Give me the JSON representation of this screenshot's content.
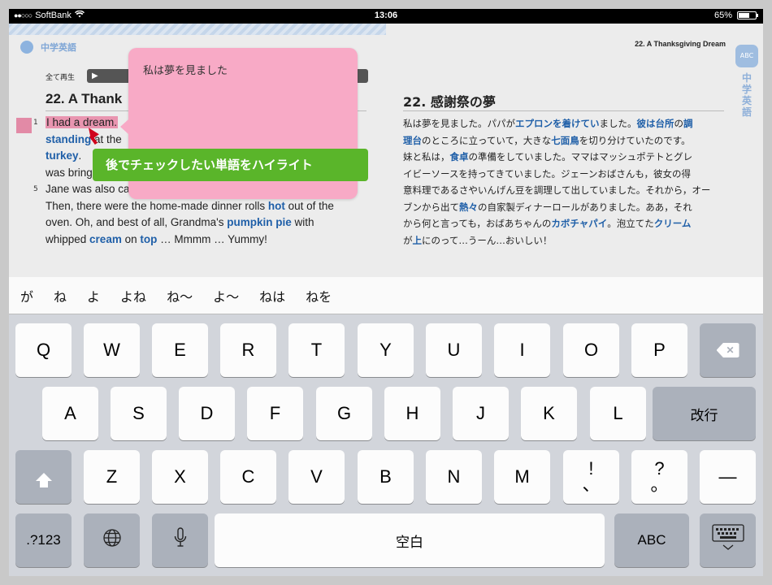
{
  "status_bar": {
    "carrier": "SoftBank",
    "time": "13:06",
    "battery": "65%",
    "battery_level": 0.65
  },
  "app": {
    "logo_label": "中学英語",
    "chapter_ref": "22. A Thanksgiving Dream",
    "side_tab_label": "中学英語",
    "play_all_label": "全て再生",
    "en_title": "22. A Thank",
    "jp_title": "22. 感謝祭の夢",
    "line_numbers": [
      "1",
      "5"
    ],
    "en_segments": {
      "highlighted": "I had a dream.",
      "line2a": "standing",
      "line2b": " at the",
      "line3a": "turkey",
      "line3b": ".",
      "line4": "was bring",
      "line5": "Jane was also ca",
      "line6a": "Then, there were the home-made dinner rolls ",
      "line6b": "hot",
      "line6c": " out of the",
      "line7a": "oven.   Oh, and best of all, Grandma's ",
      "line7b": "pumpkin pie",
      "line7c": " with",
      "line8a": "whipped ",
      "line8b": "cream",
      "line8c": " on ",
      "line8d": "top",
      "line8e": " … Mmmm … Yummy!"
    },
    "jp_segments": {
      "l1a": "私は夢を見ました。パパが",
      "l1b": "エプロンを着けてい",
      "l1c": "ました。",
      "l1d": "彼は台所",
      "l1e": "の",
      "l1f": "調",
      "l2a": "理台",
      "l2b": "のところに立っていて，大きな",
      "l2c": "七面鳥",
      "l2d": "を切り分けていたのです。",
      "l3a": "妹と私は，",
      "l3b": "食卓",
      "l3c": "の準備をしていました。ママはマッシュポテトとグレ",
      "l4": "イビーソースを持ってきていました。ジェーンおばさんも，彼女の得",
      "l5": "意料理であるさやいんげん豆を調理して出していました。それから，オー",
      "l6a": "ブンから出て",
      "l6b": "熱々",
      "l6c": "の自家製ディナーロールがありました。ああ，それ",
      "l7a": "から何と言っても，おばあちゃんの",
      "l7b": "カボチャパイ",
      "l7c": "。泡立てた",
      "l7d": "クリーム",
      "l8a": "が",
      "l8b": "上",
      "l8c": "にのって…うーん…おいしい！"
    },
    "note_text": "私は夢を見ました",
    "callout_text": "後でチェックしたい単語をハイライト"
  },
  "suggestions": [
    "が",
    "ね",
    "よ",
    "よね",
    "ね〜",
    "よ〜",
    "ねは",
    "ねを"
  ],
  "keyboard": {
    "row1": [
      "Q",
      "W",
      "E",
      "R",
      "T",
      "Y",
      "U",
      "I",
      "O",
      "P"
    ],
    "row2": [
      "A",
      "S",
      "D",
      "F",
      "G",
      "H",
      "J",
      "K",
      "L"
    ],
    "return_label": "改行",
    "row3": [
      "Z",
      "X",
      "C",
      "V",
      "B",
      "N",
      "M"
    ],
    "punct1_top": "!",
    "punct1_bottom": "、",
    "punct2_top": "?",
    "punct2_bottom": "。",
    "dash": "—",
    "numbers_label": ".?123",
    "space_label": "空白",
    "abc_label": "ABC"
  },
  "colors": {
    "highlight": "#e995b0",
    "note_bg": "#f8aac6",
    "callout_bg": "#5ab52a",
    "keyword_blue": "#1f5fa8"
  }
}
